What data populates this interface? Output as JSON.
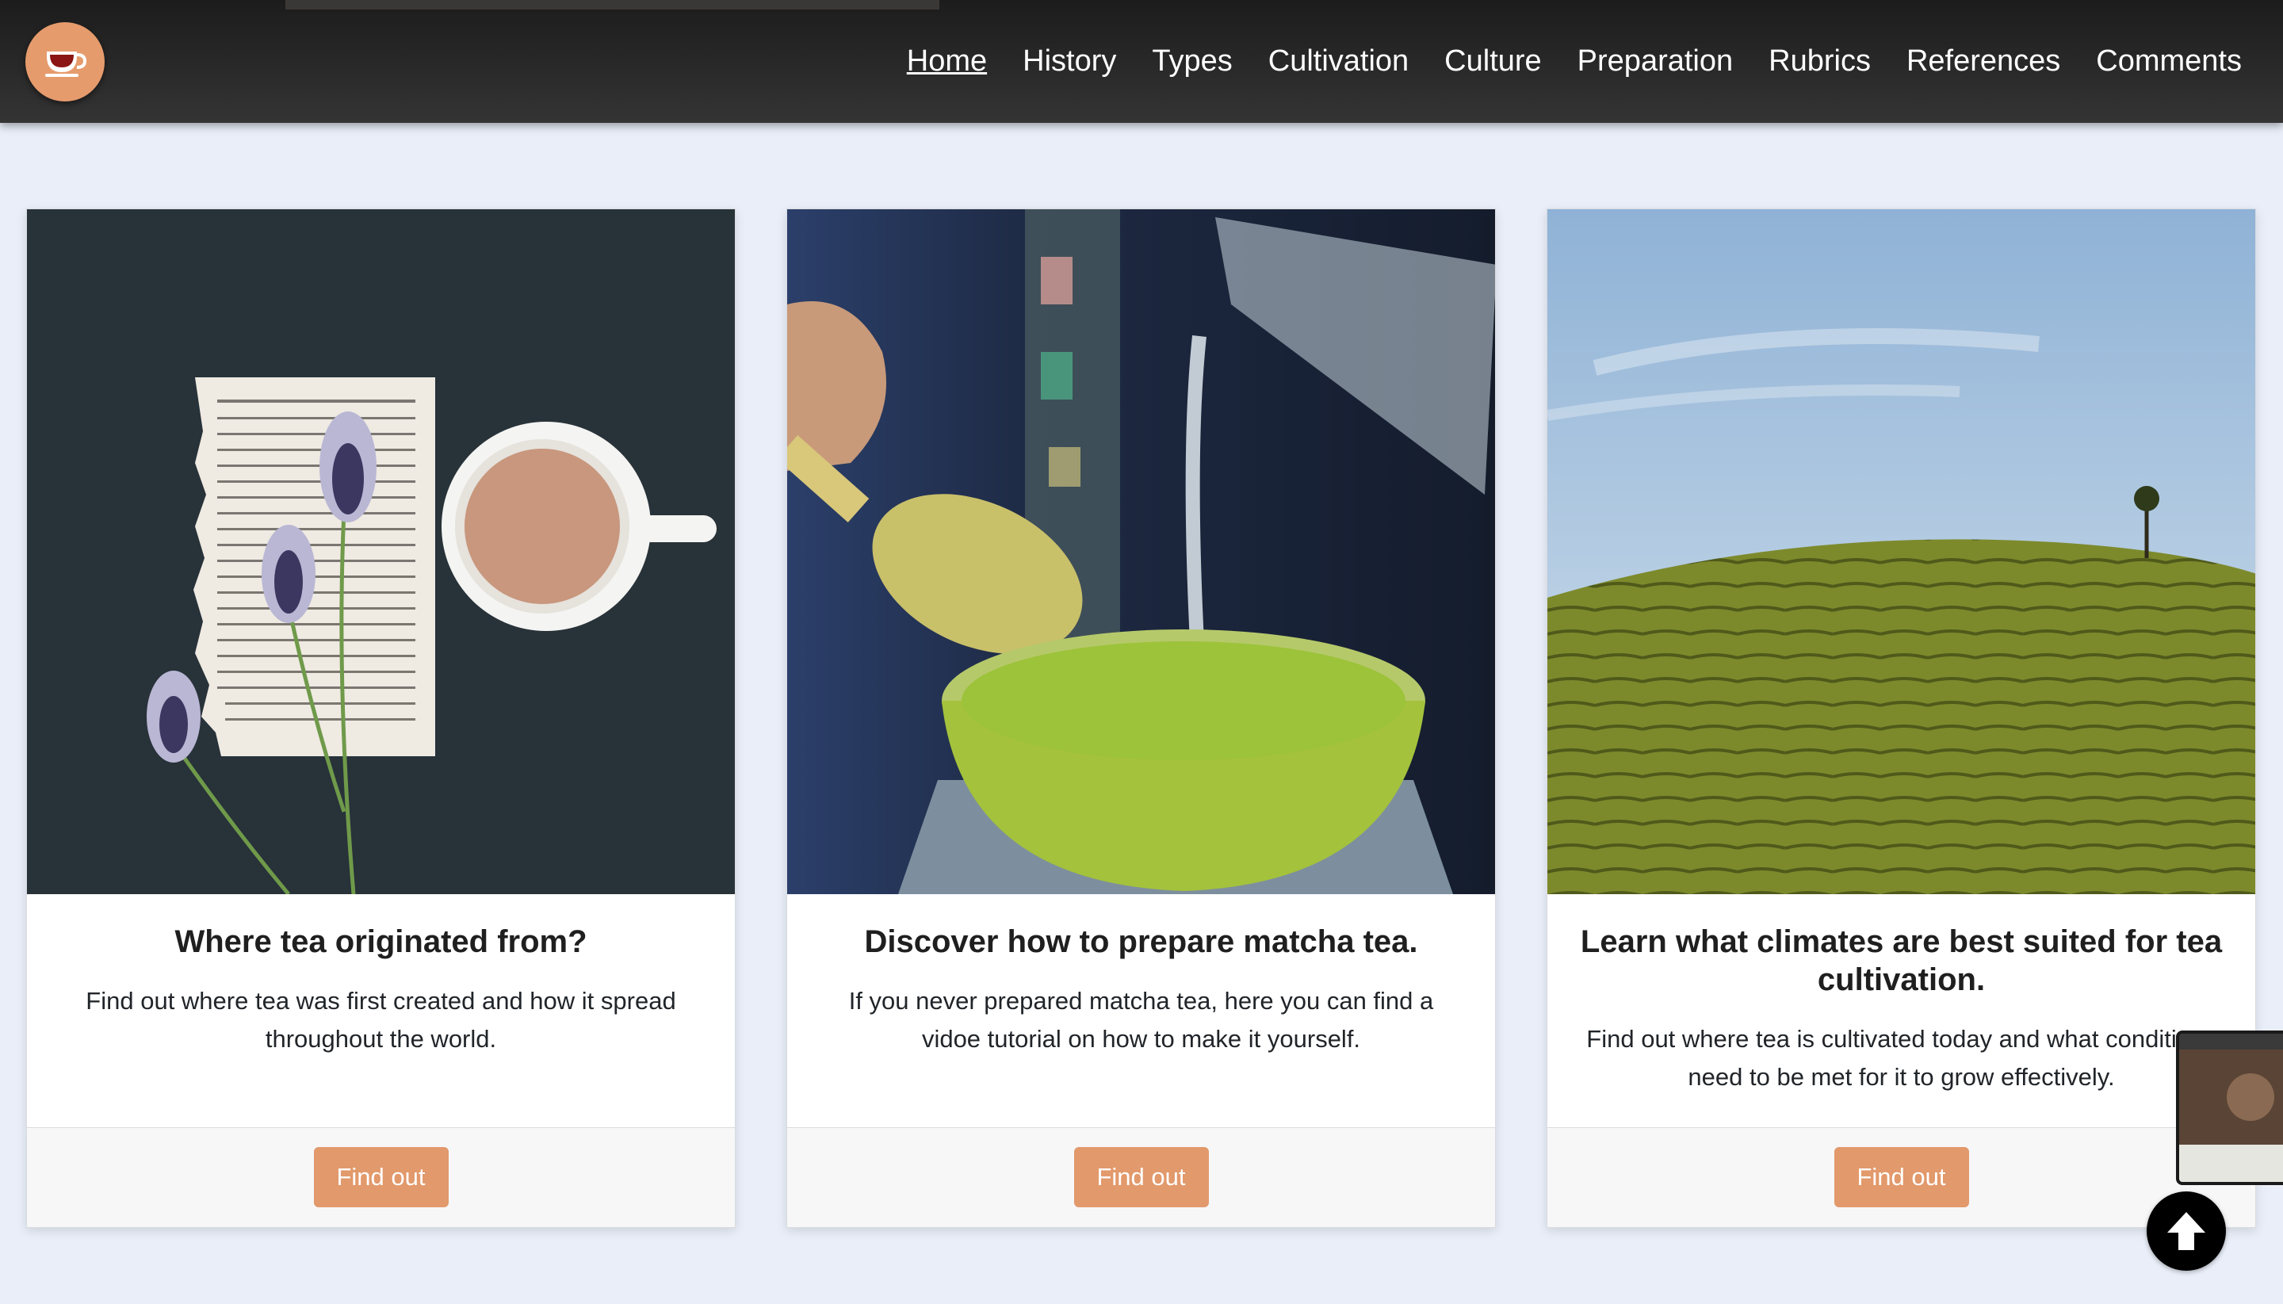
{
  "app": {
    "logo_icon": "teacup-icon",
    "accent_color": "#e2996b"
  },
  "nav": {
    "items": [
      {
        "label": "Home",
        "active": true
      },
      {
        "label": "History",
        "active": false
      },
      {
        "label": "Types",
        "active": false
      },
      {
        "label": "Cultivation",
        "active": false
      },
      {
        "label": "Culture",
        "active": false
      },
      {
        "label": "Preparation",
        "active": false
      },
      {
        "label": "Rubrics",
        "active": false
      },
      {
        "label": "References",
        "active": false
      },
      {
        "label": "Comments",
        "active": false
      }
    ]
  },
  "cards": [
    {
      "image": "tea-cup-and-book-image",
      "title": "Where tea originated from?",
      "text": "Find out where tea was first created and how it spread throughout the world.",
      "button": "Find out"
    },
    {
      "image": "matcha-preparation-image",
      "title": "Discover how to prepare matcha tea.",
      "text": "If you never prepared matcha tea, here you can find a vidoe tutorial on how to make it yourself.",
      "button": "Find out"
    },
    {
      "image": "tea-plantation-hill-image",
      "title": "Learn what climates are best suited for tea cultivation.",
      "text": "Find out where tea is cultivated today and what conditions need to be met for it to grow effectively.",
      "button": "Find out"
    }
  ],
  "overlay": {
    "thumbnail_icon": "window-thumbnail-icon",
    "scroll_top_icon": "arrow-up-icon"
  }
}
